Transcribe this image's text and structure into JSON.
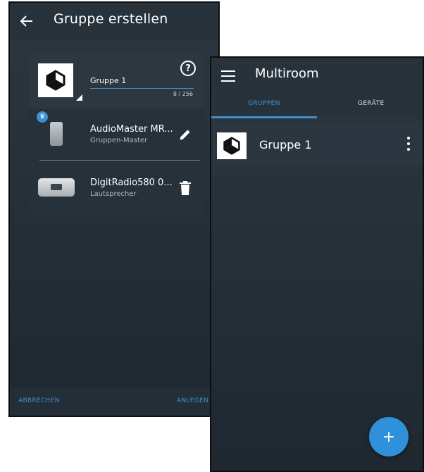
{
  "colors": {
    "accent": "#3d8fd0",
    "fab": "#2f90db",
    "background": "#253039",
    "text": "#ffffff",
    "secondary_text": "#aeb8c0"
  },
  "create_group_screen": {
    "title": "Gruppe erstellen",
    "back_icon": "arrow-left-icon",
    "help_icon": "help-circle-icon",
    "group_icon": "cube-icon",
    "group_name_value": "Gruppe 1",
    "char_count": "8 / 256",
    "devices": [
      {
        "name": "AudioMaster MR...",
        "role": "Gruppen-Master",
        "badge_icon": "crown-icon",
        "action_icon": "pencil-icon"
      },
      {
        "name": "DigitRadio580 0...",
        "role": "Lautsprecher",
        "action_icon": "trash-icon"
      }
    ],
    "cancel_label": "ABBRECHEN",
    "create_label": "ANLEGEN"
  },
  "multiroom_screen": {
    "title": "Multiroom",
    "menu_icon": "hamburger-menu-icon",
    "tabs": [
      {
        "label": "GRUPPEN",
        "selected": true
      },
      {
        "label": "GERÄTE",
        "selected": false
      }
    ],
    "groups": [
      {
        "name": "Gruppe 1",
        "icon": "cube-icon",
        "more_icon": "more-vertical-icon"
      }
    ],
    "fab_label": "+",
    "fab_icon": "plus-icon"
  }
}
